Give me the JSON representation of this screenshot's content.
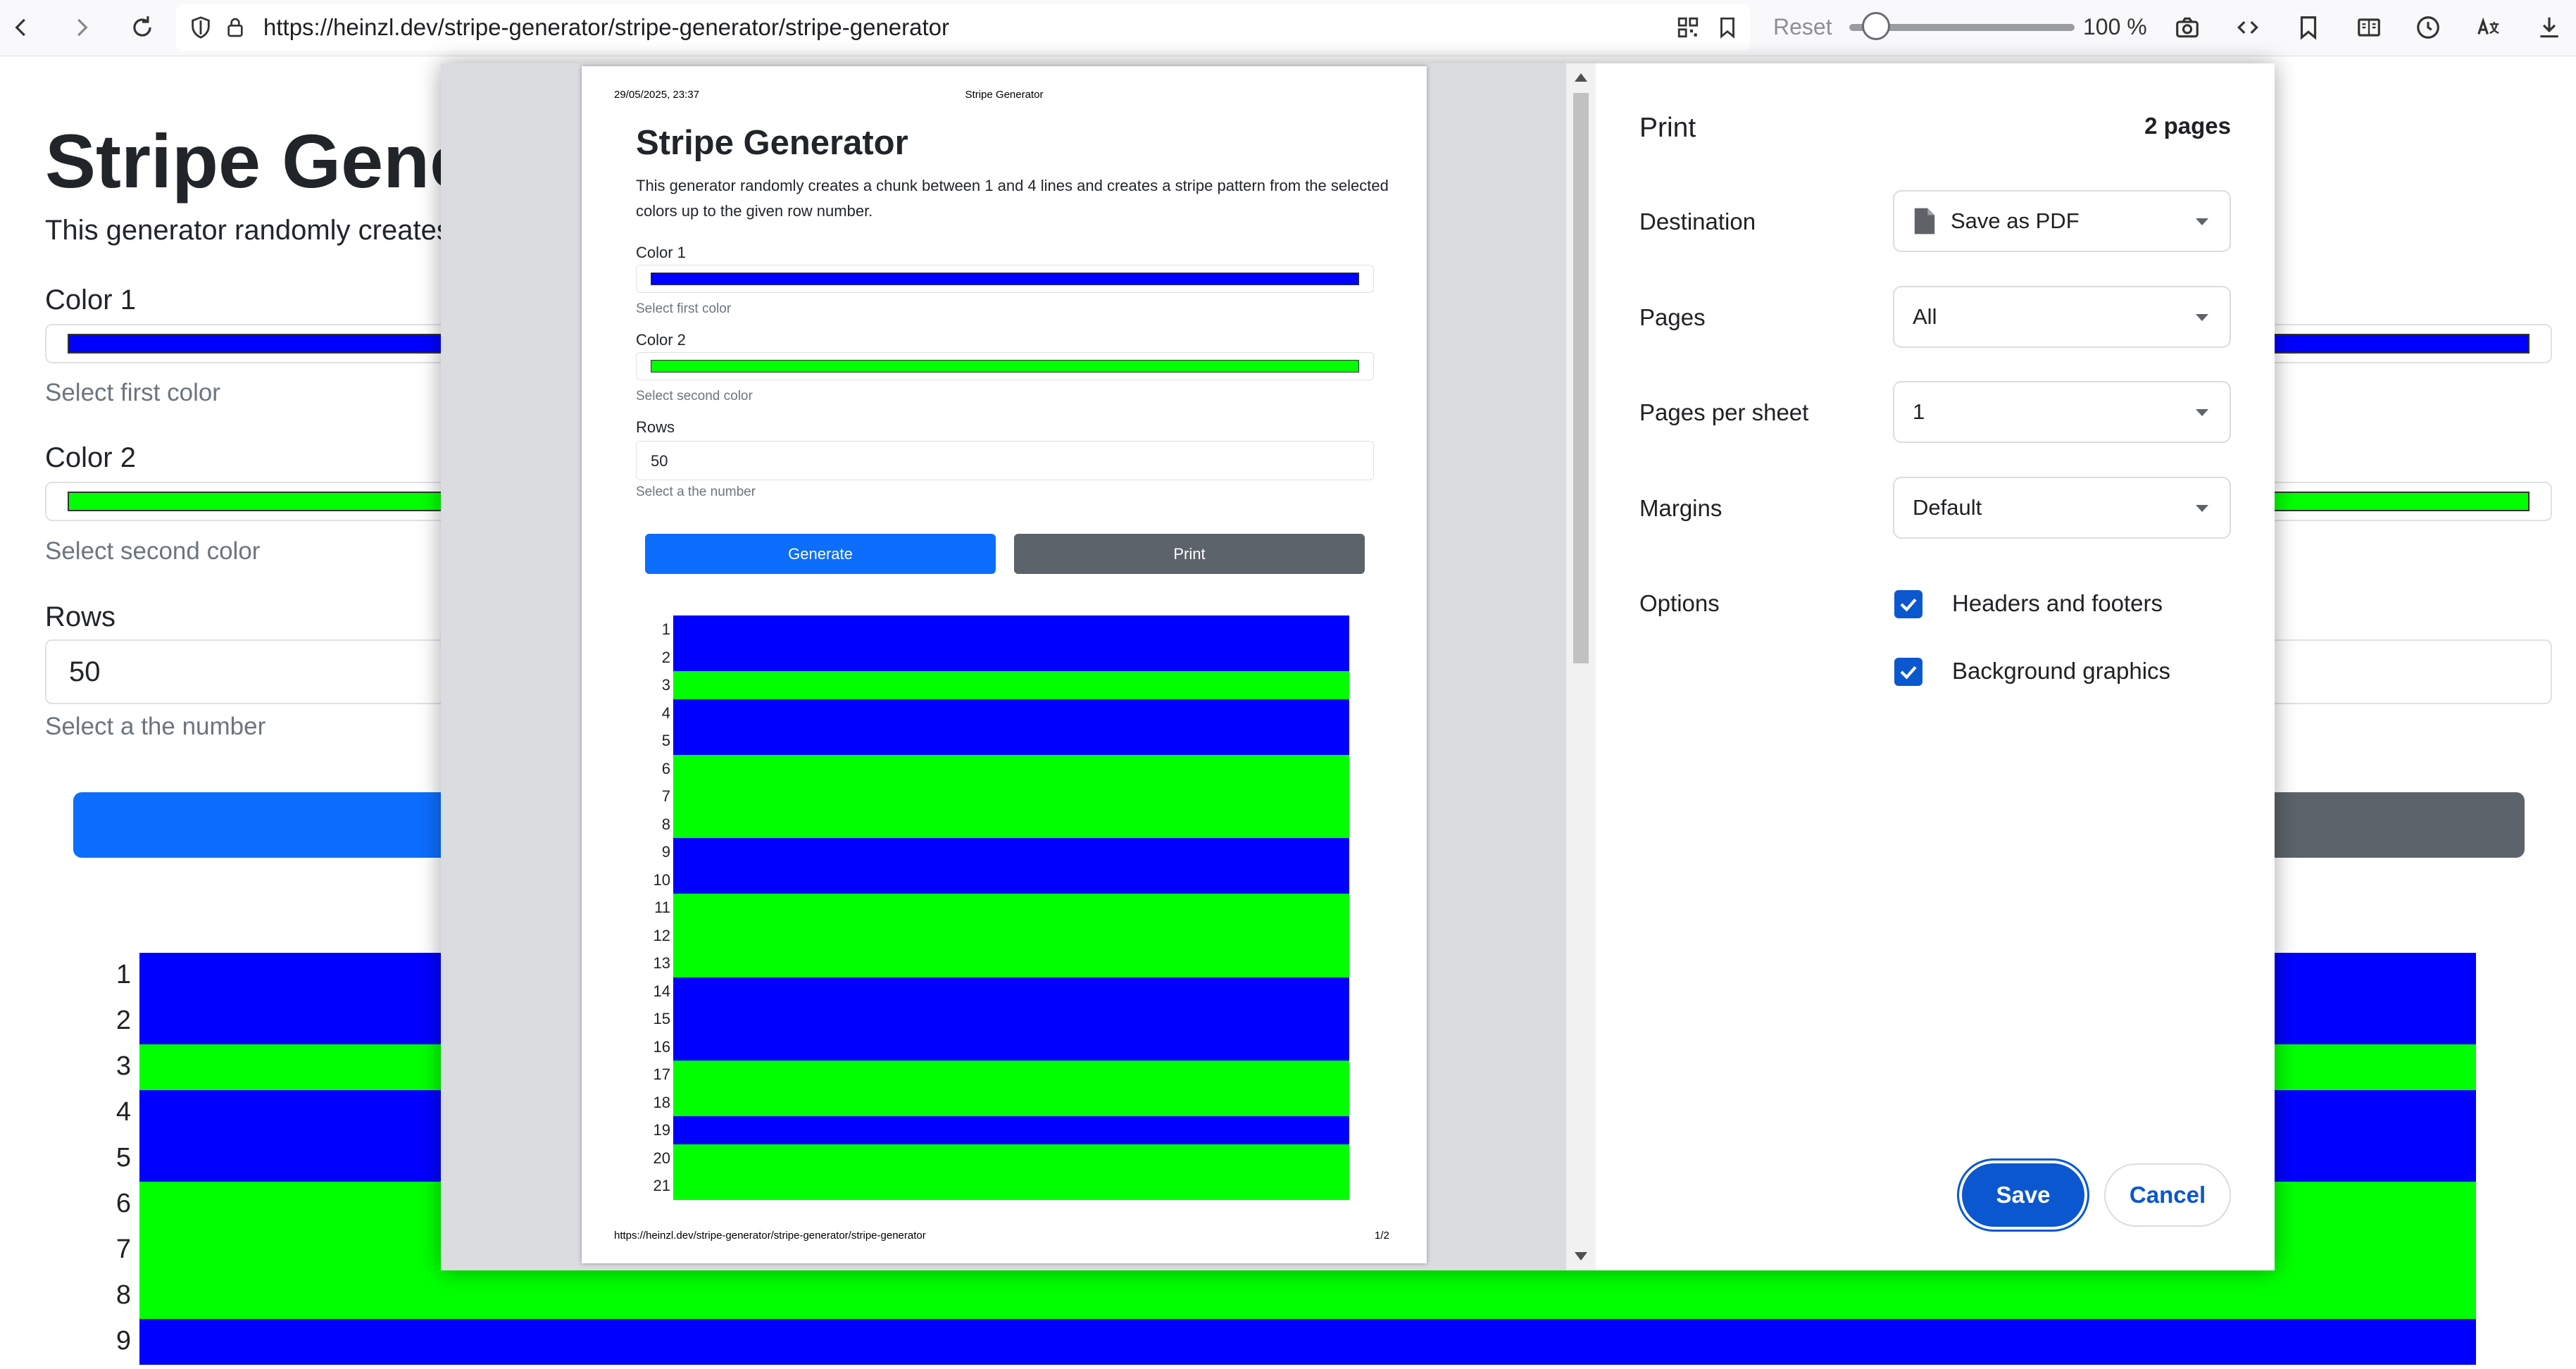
{
  "browser": {
    "url": "https://heinzl.dev/stripe-generator/stripe-generator/stripe-generator",
    "reset_label": "Reset",
    "zoom_level": "100 %",
    "zoom_fraction": 0.12
  },
  "app": {
    "title": "Stripe Generator",
    "description": "This generator randomly creates a chunk between 1 and 4 lines and creates a stripe pattern from the selected colors up to the given row number.",
    "description_visible": "This generator randomly creates",
    "color1_label": "Color 1",
    "color1_value": "#0000ff",
    "color1_help": "Select first color",
    "color2_label": "Color 2",
    "color2_value": "#00ff00",
    "color2_help": "Select second color",
    "rows_label": "Rows",
    "rows_value": "50",
    "rows_help": "Select a the number",
    "generate_label": "Generate",
    "print_label": "Print"
  },
  "stripes": [
    {
      "row": 1,
      "color": "#0000ff"
    },
    {
      "row": 2,
      "color": "#0000ff"
    },
    {
      "row": 3,
      "color": "#00ff00"
    },
    {
      "row": 4,
      "color": "#0000ff"
    },
    {
      "row": 5,
      "color": "#0000ff"
    },
    {
      "row": 6,
      "color": "#00ff00"
    },
    {
      "row": 7,
      "color": "#00ff00"
    },
    {
      "row": 8,
      "color": "#00ff00"
    },
    {
      "row": 9,
      "color": "#0000ff"
    },
    {
      "row": 10,
      "color": "#0000ff"
    },
    {
      "row": 11,
      "color": "#00ff00"
    },
    {
      "row": 12,
      "color": "#00ff00"
    },
    {
      "row": 13,
      "color": "#00ff00"
    },
    {
      "row": 14,
      "color": "#0000ff"
    },
    {
      "row": 15,
      "color": "#0000ff"
    },
    {
      "row": 16,
      "color": "#0000ff"
    },
    {
      "row": 17,
      "color": "#00ff00"
    },
    {
      "row": 18,
      "color": "#00ff00"
    },
    {
      "row": 19,
      "color": "#0000ff"
    },
    {
      "row": 20,
      "color": "#00ff00"
    },
    {
      "row": 21,
      "color": "#00ff00"
    }
  ],
  "print_preview": {
    "header_date": "29/05/2025, 23:37",
    "header_title": "Stripe Generator",
    "footer_url": "https://heinzl.dev/stripe-generator/stripe-generator/stripe-generator",
    "footer_page": "1/2"
  },
  "print_settings": {
    "title": "Print",
    "page_count": "2 pages",
    "destination_label": "Destination",
    "destination_value": "Save as PDF",
    "pages_label": "Pages",
    "pages_value": "All",
    "pages_per_sheet_label": "Pages per sheet",
    "pages_per_sheet_value": "1",
    "margins_label": "Margins",
    "margins_value": "Default",
    "options_label": "Options",
    "headers_footers_label": "Headers and footers",
    "headers_footers_checked": true,
    "background_graphics_label": "Background graphics",
    "background_graphics_checked": true,
    "save_label": "Save",
    "cancel_label": "Cancel"
  }
}
